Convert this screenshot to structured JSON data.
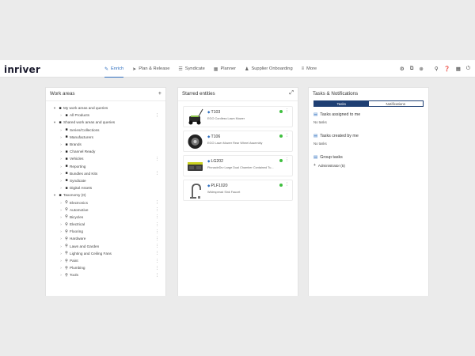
{
  "app": {
    "logo": "inriver",
    "nav": [
      {
        "label": "Enrich",
        "icon": "enrich-icon",
        "glyph": "✎",
        "active": true
      },
      {
        "label": "Plan & Release",
        "icon": "send-icon",
        "glyph": "➤",
        "active": false
      },
      {
        "label": "Syndicate",
        "icon": "rss-icon",
        "glyph": "☰",
        "active": false
      },
      {
        "label": "Planner",
        "icon": "calendar-icon",
        "glyph": "▦",
        "active": false
      },
      {
        "label": "Supplier Onboarding",
        "icon": "people-icon",
        "glyph": "♟",
        "active": false
      },
      {
        "label": "More",
        "icon": "menu-icon",
        "glyph": "≡",
        "active": false
      }
    ]
  },
  "work_areas": {
    "title": "Work areas",
    "add_glyph": "+",
    "items": [
      {
        "label": "My work areas and queries",
        "level": 0,
        "expanded": true,
        "icon": "folder",
        "menu": false
      },
      {
        "label": "All Products",
        "level": 1,
        "expanded": false,
        "icon": "folder",
        "menu": true
      },
      {
        "label": "Shared work areas and queries",
        "level": 0,
        "expanded": true,
        "icon": "folder",
        "menu": false
      },
      {
        "label": "Series/Collections",
        "level": 1,
        "expanded": false,
        "icon": "folder",
        "menu": false
      },
      {
        "label": "Manufacturers",
        "level": 1,
        "expanded": false,
        "icon": "folder",
        "menu": false
      },
      {
        "label": "Brands",
        "level": 1,
        "expanded": false,
        "icon": "folder",
        "menu": false
      },
      {
        "label": "Channel Ready",
        "level": 1,
        "expanded": false,
        "icon": "folder",
        "menu": false
      },
      {
        "label": "Vehicles",
        "level": 1,
        "expanded": false,
        "icon": "folder",
        "menu": true
      },
      {
        "label": "Reporting",
        "level": 1,
        "expanded": false,
        "icon": "folder",
        "menu": false
      },
      {
        "label": "Bundles and Kits",
        "level": 1,
        "expanded": false,
        "icon": "folder",
        "menu": true
      },
      {
        "label": "Syndicate",
        "level": 1,
        "expanded": false,
        "icon": "folder",
        "menu": false
      },
      {
        "label": "Digital Assets",
        "level": 1,
        "expanded": false,
        "icon": "folder",
        "menu": false
      },
      {
        "label": "Taxonomy (0)",
        "level": 0,
        "expanded": true,
        "icon": "folder",
        "menu": false
      },
      {
        "label": "Electronics",
        "level": 1,
        "expanded": false,
        "icon": "search",
        "menu": true
      },
      {
        "label": "Automotive",
        "level": 1,
        "expanded": false,
        "icon": "search",
        "menu": true
      },
      {
        "label": "Bicycles",
        "level": 1,
        "expanded": false,
        "icon": "search",
        "menu": true
      },
      {
        "label": "Electrical",
        "level": 1,
        "expanded": false,
        "icon": "search",
        "menu": true
      },
      {
        "label": "Flooring",
        "level": 1,
        "expanded": false,
        "icon": "search",
        "menu": true
      },
      {
        "label": "Hardware",
        "level": 1,
        "expanded": false,
        "icon": "search",
        "menu": true
      },
      {
        "label": "Lawn and Garden",
        "level": 1,
        "expanded": false,
        "icon": "search",
        "menu": true
      },
      {
        "label": "Lighting and Ceiling Fans",
        "level": 1,
        "expanded": false,
        "icon": "search",
        "menu": true
      },
      {
        "label": "Paint",
        "level": 1,
        "expanded": false,
        "icon": "search",
        "menu": true
      },
      {
        "label": "Plumbing",
        "level": 1,
        "expanded": false,
        "icon": "search",
        "menu": true
      },
      {
        "label": "Tools",
        "level": 1,
        "expanded": false,
        "icon": "search",
        "menu": true
      }
    ]
  },
  "starred": {
    "title": "Starred entities",
    "expand_glyph": "⤢",
    "items": [
      {
        "code": "T103",
        "description": "EGO Cordless Lawn Mower",
        "thumb": "mower"
      },
      {
        "code": "T106",
        "description": "EGO Lawn Mower Rear Wheel Assembly",
        "thumb": "wheel"
      },
      {
        "code": "LG202",
        "description": "PinnacleDrv Large Dual Chamber Contained Tu...",
        "thumb": "box"
      },
      {
        "code": "PLF1020",
        "description": "Widespread Sink Faucet",
        "thumb": "faucet"
      }
    ]
  },
  "tasks": {
    "title": "Tasks & Notifications",
    "tab_tasks": "Tasks",
    "tab_notifications": "Notifications",
    "assigned_title": "Tasks assigned to me",
    "assigned_empty": "No tasks",
    "created_title": "Tasks created by me",
    "created_empty": "No tasks",
    "group_title": "Group tasks",
    "group_row": "Administrator (5)"
  },
  "colors": {
    "accent": "#2f6fbf",
    "tab_active": "#1e3f73",
    "status_green": "#3fbf3f"
  }
}
